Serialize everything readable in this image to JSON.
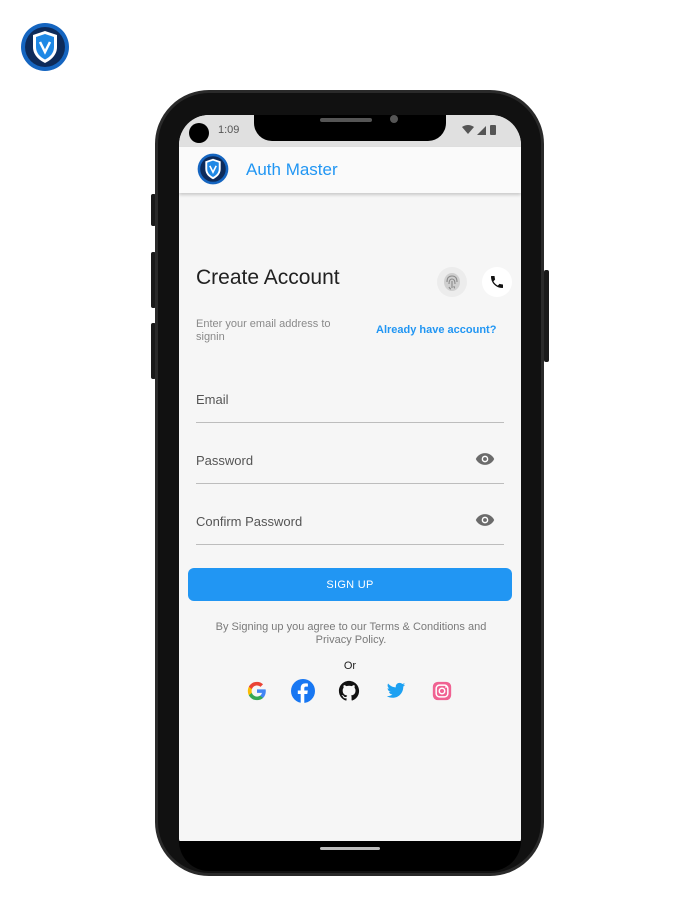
{
  "icons": {
    "brand_logo": "shield-logo",
    "fingerprint": "fingerprint-icon",
    "phone": "phone-icon",
    "password_visibility": "eye-icon",
    "social": [
      "google-icon",
      "facebook-icon",
      "github-icon",
      "twitter-icon",
      "instagram-icon"
    ]
  },
  "status_bar": {
    "time": "1:09"
  },
  "app_bar": {
    "title": "Auth Master"
  },
  "form": {
    "heading": "Create Account",
    "subtitle": "Enter your email address to signin",
    "login_link": "Already have account?",
    "email": {
      "placeholder": "Email",
      "value": ""
    },
    "password": {
      "placeholder": "Password",
      "value": ""
    },
    "confirm_password": {
      "placeholder": "Confirm Password",
      "value": ""
    },
    "signup_label": "SIGN UP",
    "terms": "By Signing up you agree to our Terms & Conditions and Privacy Policy.",
    "or_label": "Or"
  },
  "colors": {
    "primary": "#2196f3",
    "background": "#f6f6f6",
    "google_blue": "#4285f4",
    "facebook": "#1877f2",
    "twitter": "#1da1f2",
    "instagram": "#e1306c"
  }
}
